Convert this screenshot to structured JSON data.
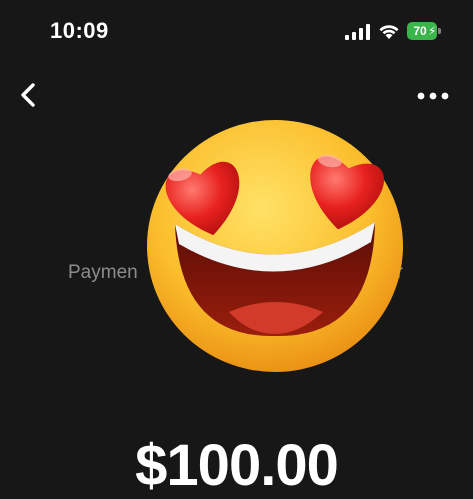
{
  "status_bar": {
    "time": "10:09",
    "battery_level": "70",
    "battery_color": "#39b54a",
    "icons": [
      "cellular-signal-icon",
      "wifi-icon",
      "battery-charging-icon"
    ]
  },
  "nav": {
    "back_icon": "chevron-left-icon",
    "more_icon": "ellipsis-icon"
  },
  "payment": {
    "label_start": "Paymen",
    "label_end": "or",
    "amount": "$100.00"
  },
  "sticker": {
    "icon": "heart-eyes-emoji"
  },
  "colors": {
    "background": "#171717",
    "label": "#8c8c8c",
    "text": "#ffffff"
  }
}
